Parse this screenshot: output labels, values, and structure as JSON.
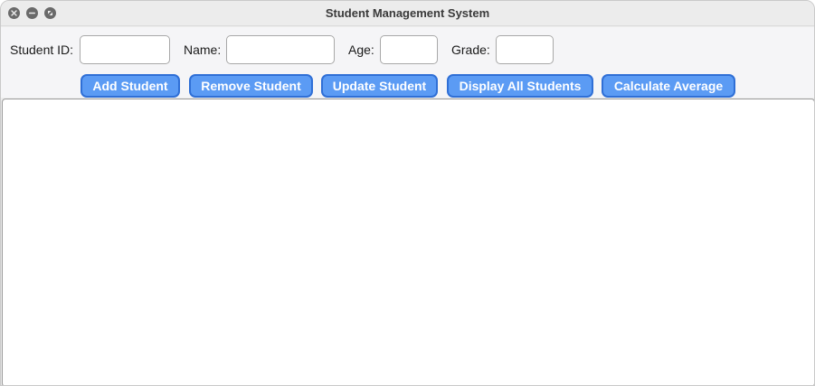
{
  "window": {
    "title": "Student Management System"
  },
  "form": {
    "student_id_label": "Student ID:",
    "student_id_value": "",
    "name_label": "Name:",
    "name_value": "",
    "age_label": "Age:",
    "age_value": "",
    "grade_label": "Grade:",
    "grade_value": ""
  },
  "buttons": {
    "add": "Add Student",
    "remove": "Remove Student",
    "update": "Update Student",
    "display_all": "Display All Students",
    "average": "Calculate Average"
  },
  "output": {
    "text": ""
  },
  "colors": {
    "button_fill": "#5b9bf4",
    "button_border": "#2f6fd6",
    "window_background": "#ececec"
  }
}
